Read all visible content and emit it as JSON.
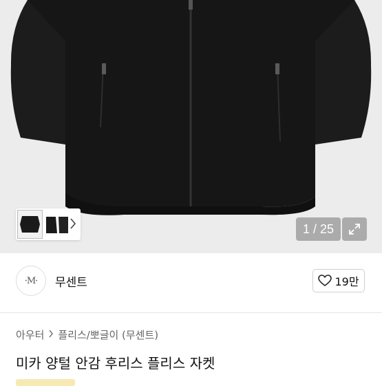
{
  "gallery": {
    "counter": "1 / 25",
    "icons": {
      "thumbnail_next": "chevron-right-icon",
      "expand": "expand-icon"
    }
  },
  "seller": {
    "avatar_text": "·M·",
    "name": "무센트",
    "like_count": "19만",
    "like_icon": "heart-outline-icon"
  },
  "breadcrumb": {
    "items": [
      "아우터",
      "플리스/뽀글이 (무센트)"
    ],
    "separator_icon": "chevron-right-icon"
  },
  "product": {
    "title": "미카 양털 안감 후리스 플리스 자켓"
  },
  "colors": {
    "hero_bg": "#ececec",
    "jacket": "#161616",
    "overlay": "#969696",
    "badge": "#f6e9b3"
  }
}
